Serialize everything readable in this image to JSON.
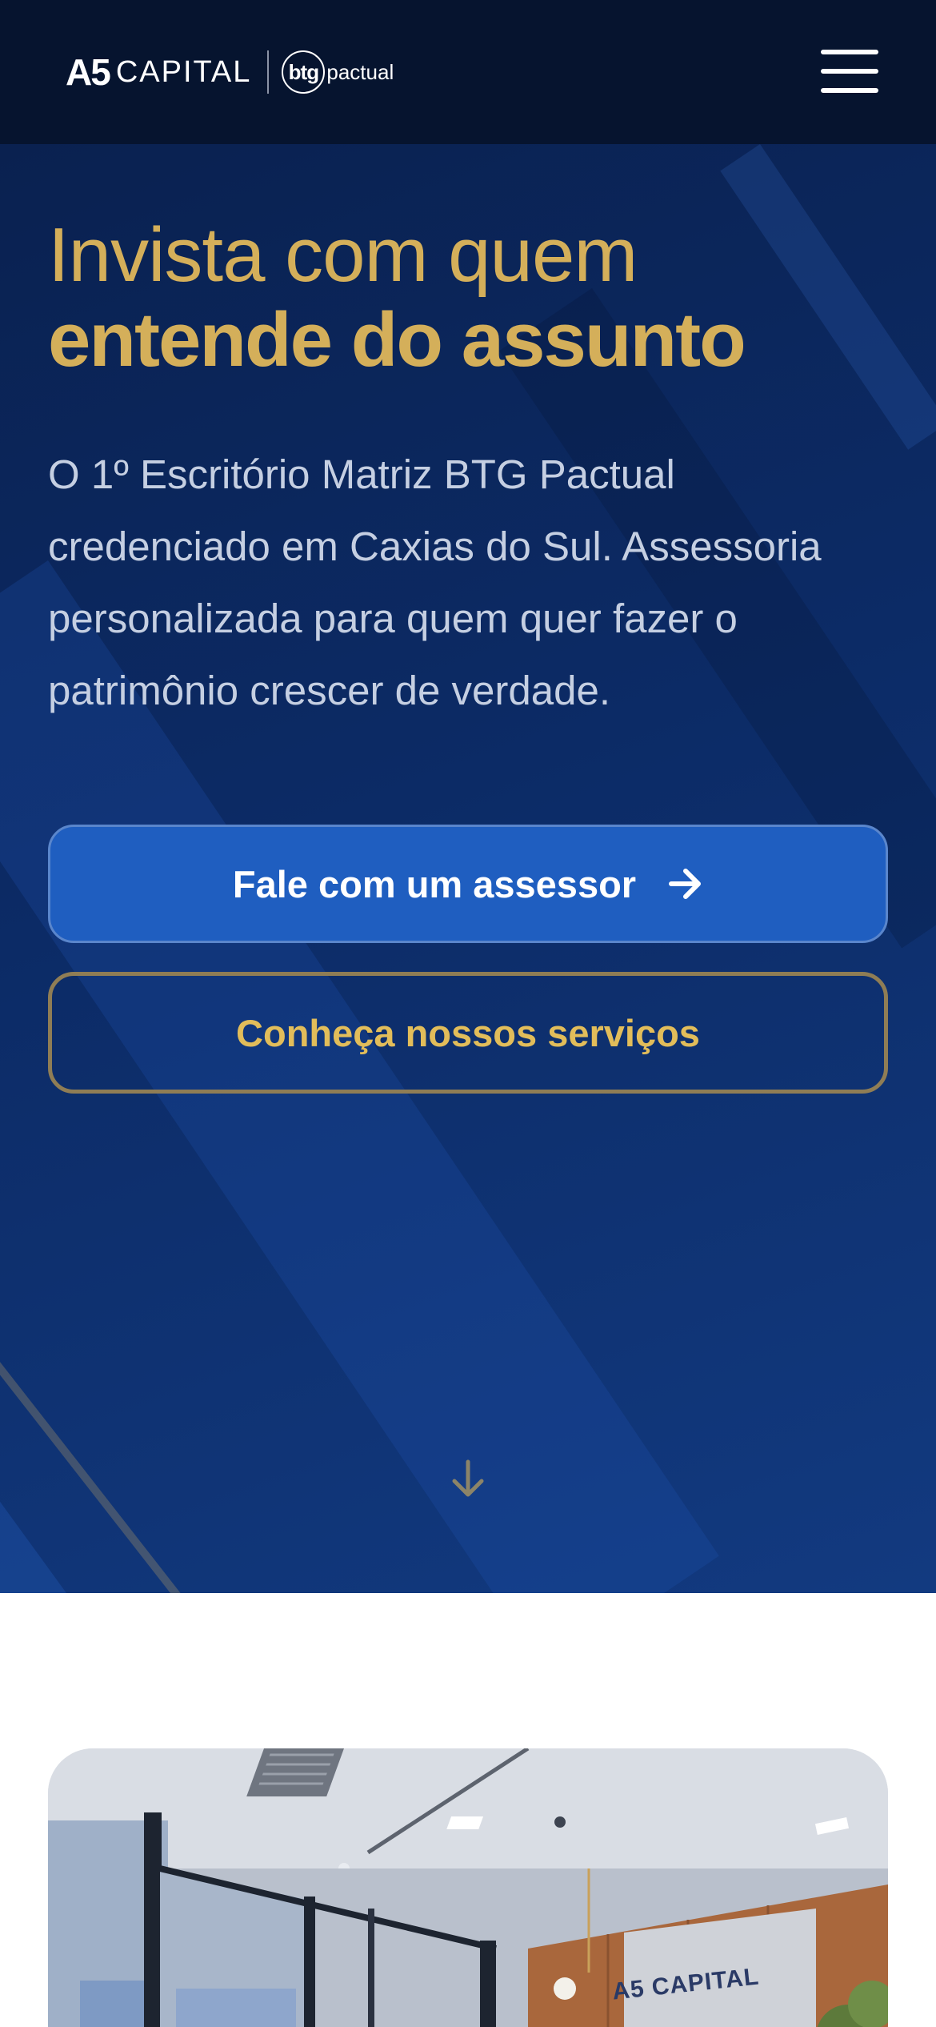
{
  "header": {
    "logo_a5": "A5",
    "logo_capital": "CAPITAL",
    "logo_btg": "btg",
    "logo_pactual": "pactual",
    "menu_icon": "hamburger-menu-icon"
  },
  "hero": {
    "headline_light": "Invista com quem",
    "headline_bold": "entende do assunto",
    "subtext": "O 1º Escritório Matriz BTG Pactual credenciado em Caxias do Sul. Assessoria personalizada para quem quer fazer o patrimônio crescer de verdade.",
    "primary_cta": "Fale com um assessor",
    "primary_cta_icon": "arrow-right-icon",
    "secondary_cta": "Conheça nossos serviços",
    "scroll_icon": "arrow-down-icon"
  },
  "office_photo": {
    "sign_text": "A5 CAPITAL"
  },
  "colors": {
    "header_bg": "#06142f",
    "hero_bg": "#0c2b66",
    "gold": "#d4af5a",
    "primary_button": "#1f5ec0",
    "subtext": "#c5cfe2"
  }
}
